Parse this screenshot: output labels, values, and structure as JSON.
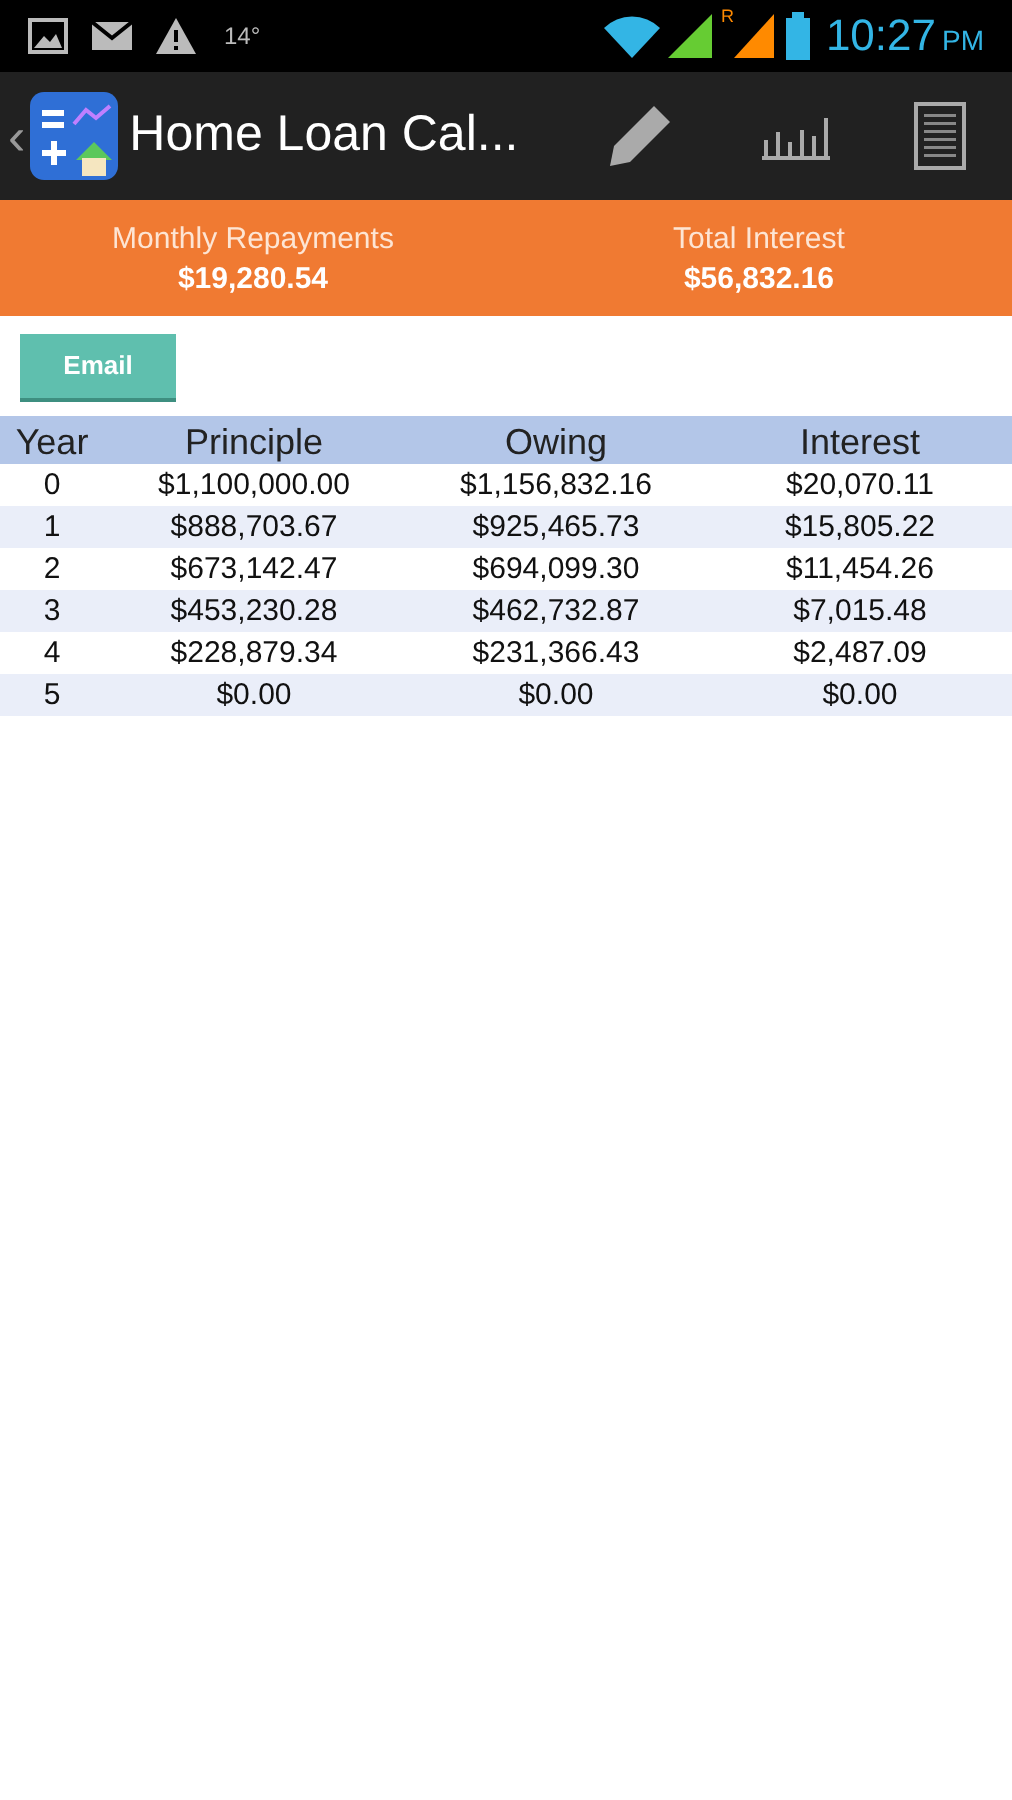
{
  "status_bar": {
    "temperature": "14°",
    "roaming": "R",
    "time": "10:27",
    "ampm": "PM"
  },
  "action_bar": {
    "back": "‹",
    "title": "Home Loan Cal..."
  },
  "summary": [
    {
      "label": "Monthly Repayments",
      "value": "$19,280.54"
    },
    {
      "label": "Total Interest",
      "value": "$56,832.16"
    }
  ],
  "email_button": "Email",
  "table": {
    "columns": [
      "Year",
      "Principle",
      "Owing",
      "Interest"
    ],
    "rows": [
      [
        "0",
        "$1,100,000.00",
        "$1,156,832.16",
        "$20,070.11"
      ],
      [
        "1",
        "$888,703.67",
        "$925,465.73",
        "$15,805.22"
      ],
      [
        "2",
        "$673,142.47",
        "$694,099.30",
        "$11,454.26"
      ],
      [
        "3",
        "$453,230.28",
        "$462,732.87",
        "$7,015.48"
      ],
      [
        "4",
        "$228,879.34",
        "$231,366.43",
        "$2,487.09"
      ],
      [
        "5",
        "$0.00",
        "$0.00",
        "$0.00"
      ]
    ]
  }
}
